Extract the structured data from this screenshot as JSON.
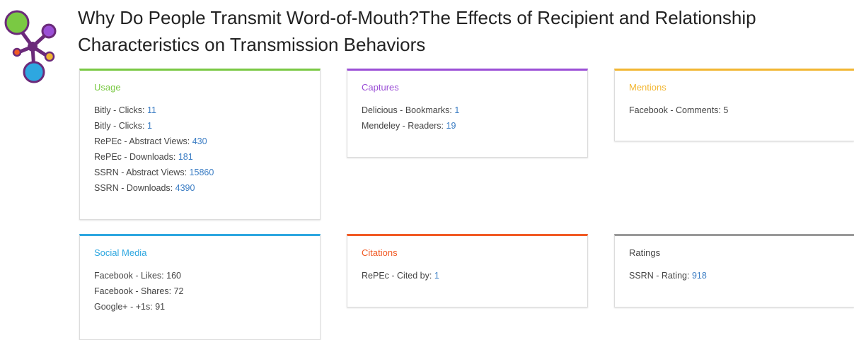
{
  "title": {
    "line1": "Why Do People Transmit Word-of-Mouth?The Effects of Recipient and Relationship",
    "line2": "Characteristics on Transmission Behaviors"
  },
  "colors": {
    "usage": "#7ac943",
    "captures": "#9b4fd6",
    "mentions": "#f2b632",
    "social_media": "#2ea7e0",
    "citations": "#f15a24",
    "ratings": "#999999",
    "link": "#3b7dc4"
  },
  "cards": {
    "usage": {
      "heading": "Usage",
      "rows": [
        {
          "label": "Bitly - Clicks:",
          "value": "11"
        },
        {
          "label": "Bitly - Clicks:",
          "value": "1"
        },
        {
          "label": "RePEc - Abstract Views:",
          "value": "430"
        },
        {
          "label": "RePEc - Downloads:",
          "value": "181"
        },
        {
          "label": "SSRN - Abstract Views:",
          "value": "15860"
        },
        {
          "label": "SSRN - Downloads:",
          "value": "4390"
        }
      ]
    },
    "captures": {
      "heading": "Captures",
      "rows": [
        {
          "label": "Delicious - Bookmarks:",
          "value": "1"
        },
        {
          "label": "Mendeley - Readers:",
          "value": "19"
        }
      ]
    },
    "mentions": {
      "heading": "Mentions",
      "rows": [
        {
          "label": "Facebook - Comments:",
          "value": "5"
        }
      ]
    },
    "social_media": {
      "heading": "Social Media",
      "rows": [
        {
          "label": "Facebook - Likes:",
          "value": "160"
        },
        {
          "label": "Facebook - Shares:",
          "value": "72"
        },
        {
          "label": "Google+ - +1s:",
          "value": "91"
        }
      ]
    },
    "citations": {
      "heading": "Citations",
      "rows": [
        {
          "label": "RePEc - Cited by:",
          "value": "1"
        }
      ]
    },
    "ratings": {
      "heading": "Ratings",
      "rows": [
        {
          "label": "SSRN - Rating:",
          "value": "918"
        }
      ]
    }
  }
}
